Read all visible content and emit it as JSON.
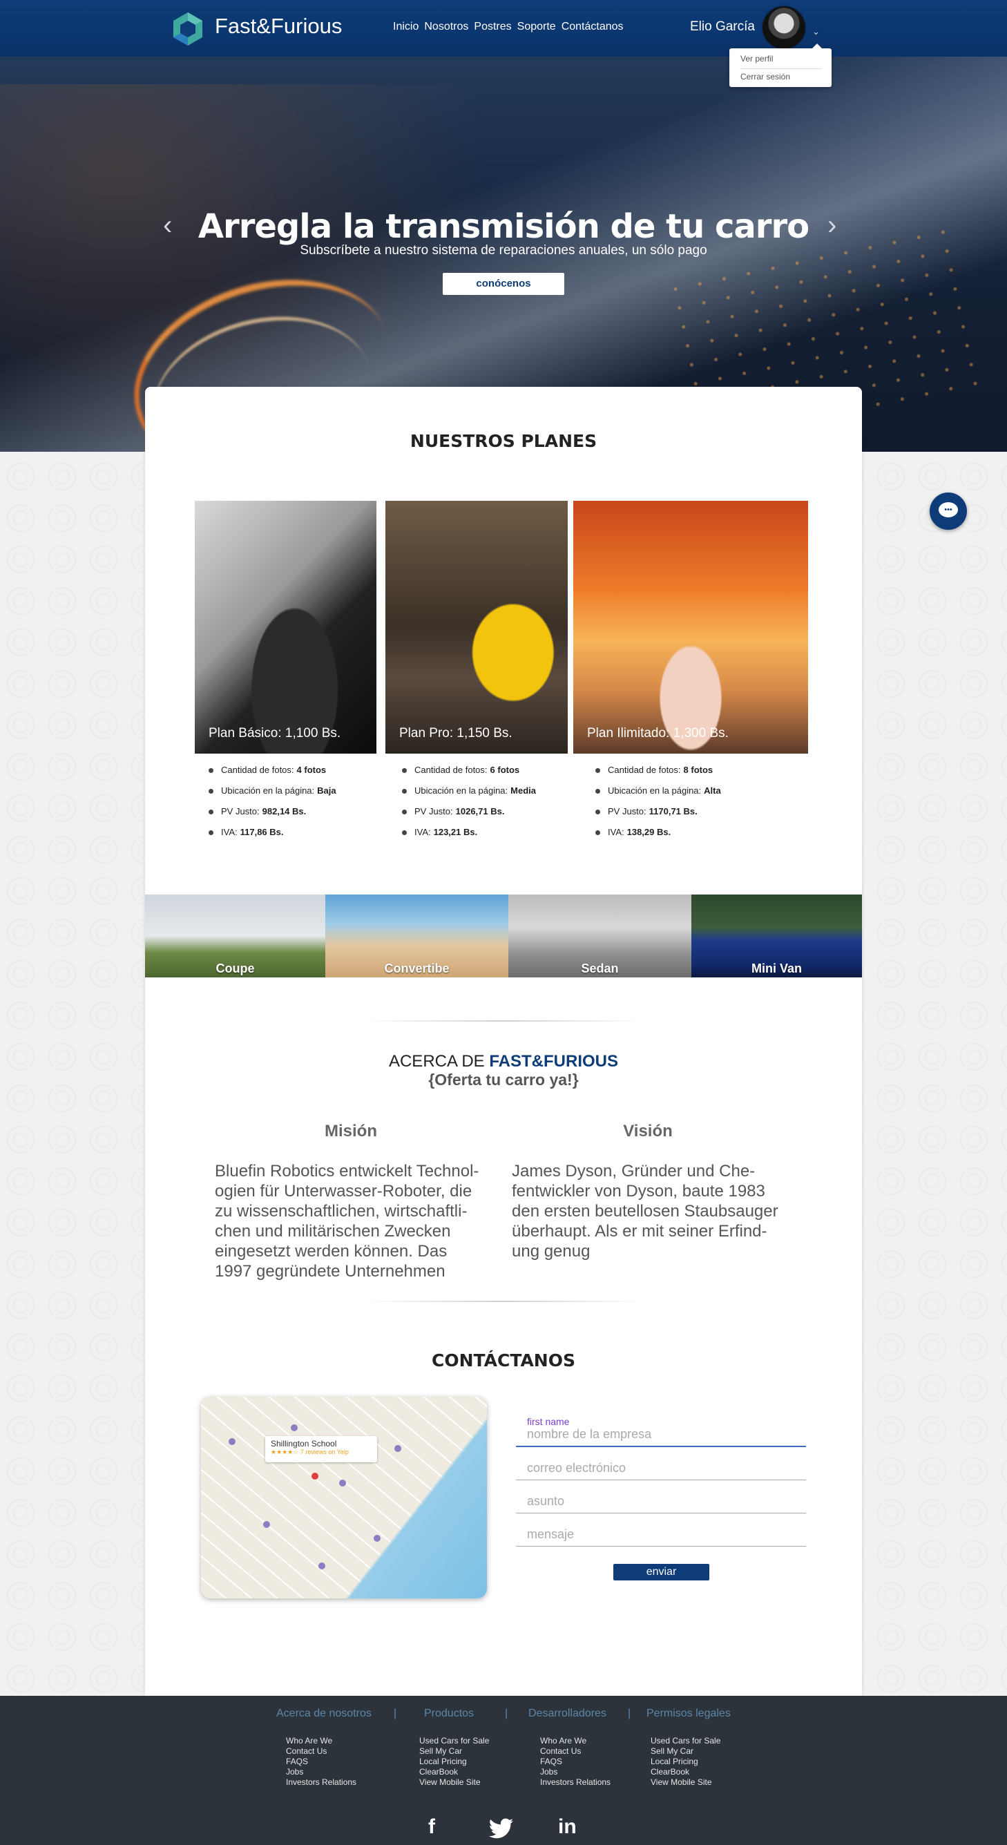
{
  "header": {
    "brand": "Fast&Furious",
    "nav": [
      "Inicio",
      "Nosotros",
      "Postres",
      "Soporte",
      "Contáctanos"
    ],
    "user_name": "Elio García",
    "dropdown": [
      "Ver perfil",
      "Cerrar sesión"
    ]
  },
  "hero": {
    "title": "Arregla la transmisión de tu carro",
    "subtitle": "Subscríbete a nuestro sistema de reparaciones anuales, un sólo pago",
    "button": "conócenos"
  },
  "plans": {
    "title": "NUESTROS PLANES",
    "items": [
      {
        "label": "Plan Básico:  1,100 Bs.",
        "fotos": "4 fotos",
        "ubicacion": "Baja",
        "pv": "982,14 Bs.",
        "iva": "117,86 Bs."
      },
      {
        "label": "Plan Pro:  1,150 Bs.",
        "fotos": "6 fotos",
        "ubicacion": "Media",
        "pv": "1026,71 Bs.",
        "iva": "123,21 Bs."
      },
      {
        "label": "Plan Ilimitado:  1,300 Bs.",
        "fotos": "8 fotos",
        "ubicacion": "Alta",
        "pv": "1170,71 Bs.",
        "iva": "138,29 Bs."
      }
    ],
    "feature_labels": [
      "Cantidad de fotos:",
      "Ubicación en la página:",
      "PV Justo:",
      "IVA:"
    ]
  },
  "car_types": [
    "Coupe",
    "Convertibe",
    "Sedan",
    "Mini Van"
  ],
  "about": {
    "prefix": "ACERCA DE ",
    "brand": "FAST&FURIOUS",
    "tagline": "{Oferta tu carro ya!}",
    "mision_title": "Misión",
    "mision_text": "Bluefin Robotics entwickelt Technol-ogien für Unterwasser-Roboter, die zu wissenschaftlichen, wirtschaftli-chen und militärischen Zwecken eingesetzt werden können. Das 1997 gegründete Unternehmen",
    "vision_title": "Visión",
    "vision_text": "James Dyson, Gründer und Che-fentwickler von Dyson, baute 1983 den ersten beutellosen Staubsauger überhaupt. Als er mit seiner Erfind-ung genug"
  },
  "contact": {
    "title": "CONTÁCTANOS",
    "map_place": "Shillington School",
    "map_reviews": "★★★★☆ 7 reviews on Yelp",
    "field_label": "first name",
    "fields": [
      "nombre de la empresa",
      "correo electrónico",
      "asunto",
      "mensaje"
    ],
    "send": "enviar"
  },
  "footer": {
    "headings": [
      "Acerca de nosotros",
      "Productos",
      "Desarrolladores",
      "Permisos legales"
    ],
    "col1": [
      "Who Are We",
      "Contact Us",
      "FAQS",
      "Jobs",
      "Investors Relations"
    ],
    "col2": [
      "Used Cars for Sale",
      "Sell My Car",
      "Local Pricing",
      "ClearBook",
      "View Mobile Site"
    ],
    "col3": [
      "Who Are We",
      "Contact Us",
      "FAQS",
      "Jobs",
      "Investors Relations"
    ],
    "col4": [
      "Used Cars for Sale",
      "Sell My Car",
      "Local Pricing",
      "ClearBook",
      "View Mobile Site"
    ],
    "social": [
      "f",
      "twitter-icon",
      "in"
    ]
  }
}
